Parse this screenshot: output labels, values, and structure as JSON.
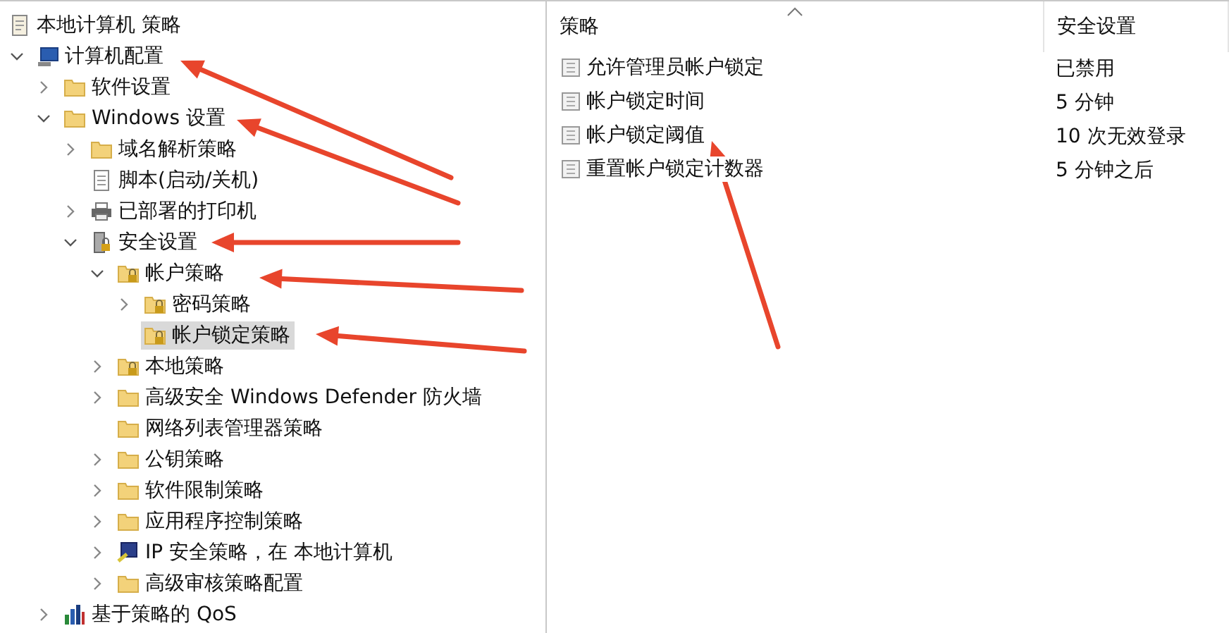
{
  "tree": {
    "root": {
      "label": "本地计算机 策略",
      "kind": "policy",
      "selected": false
    },
    "items": [
      {
        "label": "计算机配置",
        "kind": "computer",
        "expandable": true,
        "expanded": true,
        "selected": false,
        "children": [
          {
            "label": "软件设置",
            "kind": "folder",
            "expandable": true,
            "expanded": false,
            "selected": false
          },
          {
            "label": "Windows 设置",
            "kind": "folder",
            "expandable": true,
            "expanded": true,
            "selected": false,
            "children": [
              {
                "label": "域名解析策略",
                "kind": "folder",
                "expandable": true,
                "expanded": false,
                "selected": false
              },
              {
                "label": "脚本(启动/关机)",
                "kind": "script",
                "expandable": false,
                "expanded": false,
                "selected": false
              },
              {
                "label": "已部署的打印机",
                "kind": "printer",
                "expandable": true,
                "expanded": false,
                "selected": false
              },
              {
                "label": "安全设置",
                "kind": "security",
                "expandable": true,
                "expanded": true,
                "selected": false,
                "children": [
                  {
                    "label": "帐户策略",
                    "kind": "folder-lock",
                    "expandable": true,
                    "expanded": true,
                    "selected": false,
                    "children": [
                      {
                        "label": "密码策略",
                        "kind": "folder-lock",
                        "expandable": true,
                        "expanded": false,
                        "selected": false
                      },
                      {
                        "label": "帐户锁定策略",
                        "kind": "folder-lock",
                        "expandable": false,
                        "expanded": false,
                        "selected": true
                      }
                    ]
                  },
                  {
                    "label": "本地策略",
                    "kind": "folder-lock",
                    "expandable": true,
                    "expanded": false,
                    "selected": false
                  },
                  {
                    "label": "高级安全 Windows Defender 防火墙",
                    "kind": "folder",
                    "expandable": true,
                    "expanded": false,
                    "selected": false
                  },
                  {
                    "label": "网络列表管理器策略",
                    "kind": "folder",
                    "expandable": false,
                    "expanded": false,
                    "selected": false
                  },
                  {
                    "label": "公钥策略",
                    "kind": "folder",
                    "expandable": true,
                    "expanded": false,
                    "selected": false
                  },
                  {
                    "label": "软件限制策略",
                    "kind": "folder",
                    "expandable": true,
                    "expanded": false,
                    "selected": false
                  },
                  {
                    "label": "应用程序控制策略",
                    "kind": "folder",
                    "expandable": true,
                    "expanded": false,
                    "selected": false
                  },
                  {
                    "label": "IP 安全策略，在 本地计算机",
                    "kind": "ip",
                    "expandable": true,
                    "expanded": false,
                    "selected": false
                  },
                  {
                    "label": "高级审核策略配置",
                    "kind": "folder",
                    "expandable": true,
                    "expanded": false,
                    "selected": false
                  }
                ]
              }
            ]
          },
          {
            "label": "基于策略的 QoS",
            "kind": "qos",
            "expandable": true,
            "expanded": false,
            "selected": false
          }
        ]
      }
    ]
  },
  "table": {
    "columns": [
      {
        "label": "策略",
        "sorted": true
      },
      {
        "label": "安全设置",
        "sorted": false
      }
    ],
    "rows": [
      {
        "policy": "允许管理员帐户锁定",
        "setting": "已禁用"
      },
      {
        "policy": "帐户锁定时间",
        "setting": "5 分钟"
      },
      {
        "policy": "帐户锁定阈值",
        "setting": "10 次无效登录"
      },
      {
        "policy": "重置帐户锁定计数器",
        "setting": "5 分钟之后"
      }
    ]
  }
}
